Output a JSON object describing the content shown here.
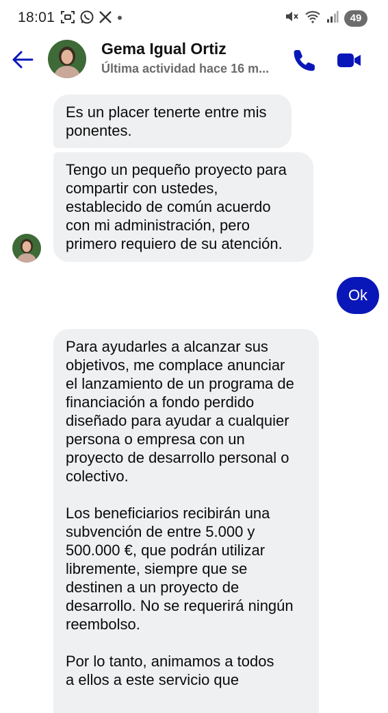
{
  "status_bar": {
    "time": "18:01",
    "left_icons": [
      "screenshot-icon",
      "whatsapp-icon",
      "x-icon",
      "dot-icon"
    ],
    "right_icons": [
      "mute-icon",
      "wifi-icon",
      "signal-icon"
    ],
    "battery": "49"
  },
  "header": {
    "contact_name": "Gema Igual Ortiz",
    "status": "Última actividad hace 16 m...",
    "accent_color": "#0a17b8"
  },
  "messages": [
    {
      "direction": "incoming",
      "text": "Es un placer tenerte entre mis\nponentes."
    },
    {
      "direction": "incoming",
      "text": "Tengo un pequeño proyecto para\ncompartir con ustedes,\nestablecido de común acuerdo\ncon mi administración, pero\nprimero requiero de su atención."
    },
    {
      "direction": "outgoing",
      "text": "Ok"
    },
    {
      "direction": "incoming",
      "text": "Para ayudarles a alcanzar sus\nobjetivos, me complace anunciar\nel lanzamiento de un programa de\nfinanciación a fondo perdido\ndiseñado para ayudar a cualquier\npersona o empresa con un\nproyecto de desarrollo personal o\ncolectivo.\n\nLos beneficiarios recibirán una\nsubvención de entre 5.000 y\n500.000 €, que podrán utilizar\nlibremente, siempre que se\ndestinen a un proyecto de\ndesarrollo. No se requerirá ningún\nreembolso.\n\nPor lo tanto, animamos a todos\na ellos a este servicio que"
    }
  ]
}
